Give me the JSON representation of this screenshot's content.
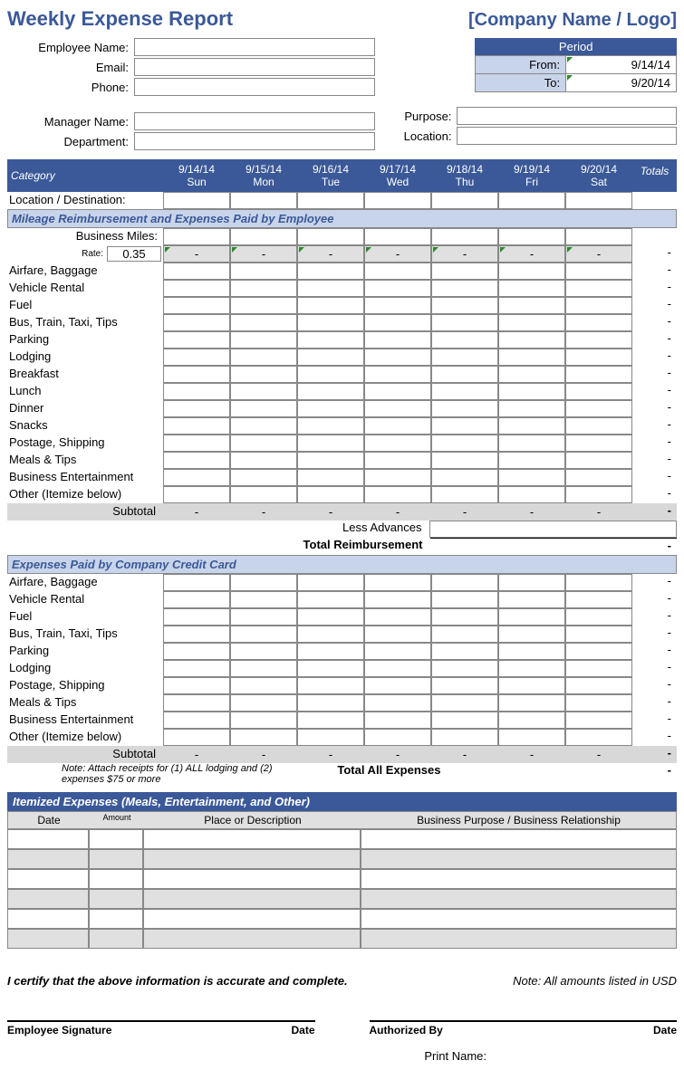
{
  "header": {
    "title": "Weekly Expense Report",
    "company": "[Company Name / Logo]"
  },
  "employee": {
    "name_label": "Employee Name:",
    "email_label": "Email:",
    "phone_label": "Phone:",
    "manager_label": "Manager Name:",
    "department_label": "Department:",
    "name": "",
    "email": "",
    "phone": "",
    "manager": "",
    "department": ""
  },
  "period": {
    "header": "Period",
    "from_label": "From:",
    "to_label": "To:",
    "from": "9/14/14",
    "to": "9/20/14"
  },
  "purpose": {
    "purpose_label": "Purpose:",
    "location_label": "Location:",
    "purpose": "",
    "location": ""
  },
  "columns": {
    "category": "Category",
    "days": [
      {
        "date": "9/14/14",
        "dow": "Sun"
      },
      {
        "date": "9/15/14",
        "dow": "Mon"
      },
      {
        "date": "9/16/14",
        "dow": "Tue"
      },
      {
        "date": "9/17/14",
        "dow": "Wed"
      },
      {
        "date": "9/18/14",
        "dow": "Thu"
      },
      {
        "date": "9/19/14",
        "dow": "Fri"
      },
      {
        "date": "9/20/14",
        "dow": "Sat"
      }
    ],
    "totals": "Totals"
  },
  "location_dest_label": "Location / Destination:",
  "section1": {
    "title": "Mileage Reimbursement and Expenses Paid by Employee",
    "business_miles": "Business Miles:",
    "rate_label": "Rate:",
    "rate": "0.35",
    "dash": "-",
    "categories": [
      "Airfare, Baggage",
      "Vehicle Rental",
      "Fuel",
      "Bus, Train, Taxi, Tips",
      "Parking",
      "Lodging",
      "Breakfast",
      "Lunch",
      "Dinner",
      "Snacks",
      "Postage, Shipping",
      "Meals & Tips",
      "Business Entertainment",
      "Other (Itemize below)"
    ],
    "subtotal": "Subtotal",
    "less_advances": "Less Advances",
    "total_reimbursement": "Total Reimbursement"
  },
  "section2": {
    "title": "Expenses Paid by Company Credit Card",
    "categories": [
      "Airfare, Baggage",
      "Vehicle Rental",
      "Fuel",
      "Bus, Train, Taxi, Tips",
      "Parking",
      "Lodging",
      "Postage, Shipping",
      "Meals & Tips",
      "Business Entertainment",
      "Other (Itemize below)"
    ],
    "subtotal": "Subtotal",
    "note": "Note:  Attach receipts for (1) ALL lodging and (2) expenses $75 or more",
    "total_all": "Total All Expenses"
  },
  "itemized": {
    "title": "Itemized Expenses (Meals, Entertainment, and Other)",
    "cols": {
      "date": "Date",
      "amount": "Amount",
      "place": "Place or Description",
      "purpose": "Business Purpose / Business Relationship"
    },
    "rows": 6
  },
  "footer": {
    "cert": "I certify that the above information is accurate and complete.",
    "usd": "Note: All amounts listed in USD",
    "emp_sig": "Employee Signature",
    "date": "Date",
    "auth": "Authorized By",
    "print_name": "Print Name:"
  }
}
